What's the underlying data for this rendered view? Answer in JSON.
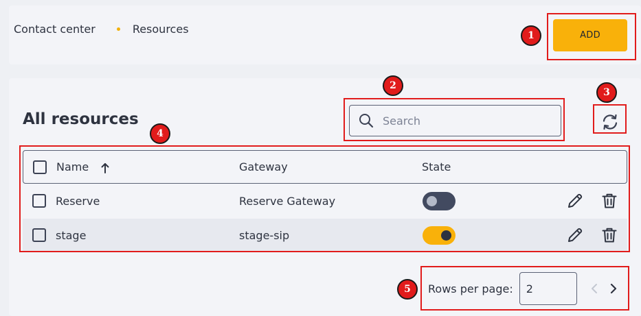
{
  "breadcrumb": {
    "items": [
      "Contact center",
      "Resources"
    ]
  },
  "header": {
    "add_label": "ADD"
  },
  "page": {
    "title": "All resources"
  },
  "search": {
    "placeholder": "Search",
    "value": ""
  },
  "table": {
    "columns": {
      "name": "Name",
      "gateway": "Gateway",
      "state": "State"
    },
    "sort": {
      "column": "Name",
      "direction": "ascending"
    },
    "rows": [
      {
        "name": "Reserve",
        "gateway": "Reserve Gateway",
        "state": "off"
      },
      {
        "name": "stage",
        "gateway": "stage-sip",
        "state": "on"
      }
    ]
  },
  "pagination": {
    "rows_label": "Rows per page:",
    "rows_value": "2"
  },
  "annotations": [
    "1",
    "2",
    "3",
    "4",
    "5"
  ],
  "colors": {
    "accent": "#f9b10a",
    "callout": "#e11b1b",
    "text": "#2e3340"
  }
}
